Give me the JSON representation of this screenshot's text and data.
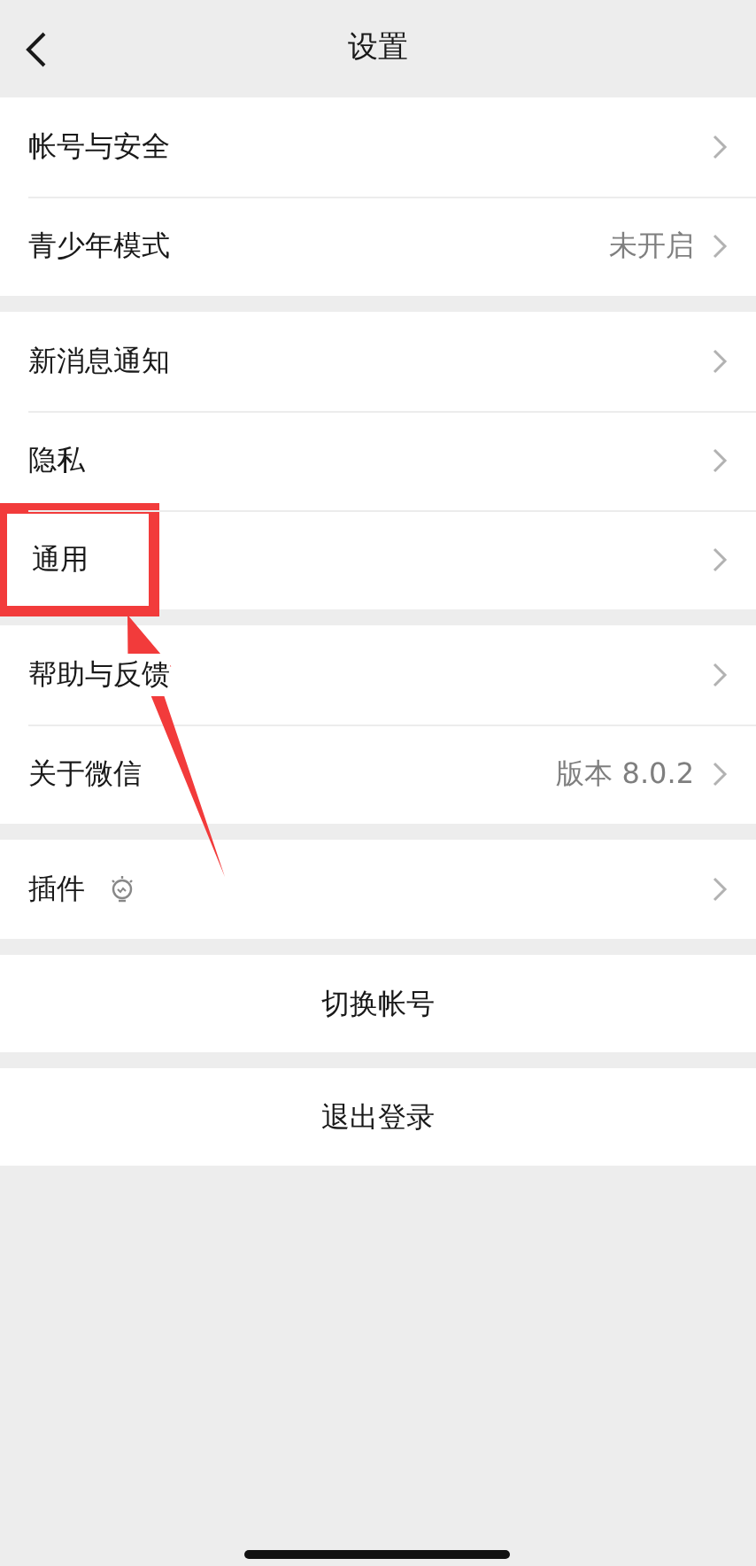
{
  "header": {
    "title": "设置"
  },
  "groups": [
    {
      "items": [
        {
          "kind": "plain",
          "label": "帐号与安全",
          "highlighted": false
        },
        {
          "kind": "plain",
          "label": "青少年模式",
          "value": "未开启",
          "highlighted": false
        }
      ]
    },
    {
      "items": [
        {
          "kind": "plain",
          "label": "新消息通知",
          "highlighted": false
        },
        {
          "kind": "plain",
          "label": "隐私",
          "highlighted": false
        },
        {
          "kind": "plain",
          "label": "通用",
          "highlighted": true
        }
      ]
    },
    {
      "items": [
        {
          "kind": "plain",
          "label": "帮助与反馈",
          "highlighted": false
        },
        {
          "kind": "plain",
          "label": "关于微信",
          "value": "版本 8.0.2",
          "highlighted": false
        }
      ]
    },
    {
      "items": [
        {
          "kind": "with-icon",
          "label": "插件",
          "highlighted": false
        }
      ]
    }
  ],
  "actions": [
    "切换帐号",
    "退出登录"
  ]
}
